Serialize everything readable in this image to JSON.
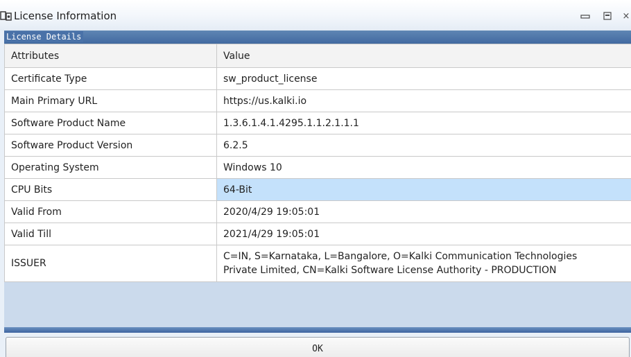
{
  "window": {
    "title": "License Information",
    "icons": {
      "app": "license-app-icon",
      "minimize": "minimize-icon",
      "maximize": "maximize-icon",
      "close": "close-icon"
    },
    "close_glyph": "×"
  },
  "group": {
    "legend": "License Details"
  },
  "table": {
    "columns": [
      "Attributes",
      "Value"
    ],
    "rows": [
      {
        "attribute": "Certificate Type",
        "value": "sw_product_license"
      },
      {
        "attribute": "Main Primary URL",
        "value": "https://us.kalki.io"
      },
      {
        "attribute": "Software Product Name",
        "value": "1.3.6.1.4.1.4295.1.1.2.1.1.1"
      },
      {
        "attribute": "Software Product Version",
        "value": "6.2.5"
      },
      {
        "attribute": "Operating System",
        "value": "Windows 10"
      },
      {
        "attribute": "CPU Bits",
        "value": "64-Bit",
        "selected": true
      },
      {
        "attribute": "Valid From",
        "value": "2020/4/29 19:05:01"
      },
      {
        "attribute": "Valid Till",
        "value": "2021/4/29 19:05:01"
      },
      {
        "attribute": "ISSUER",
        "value_line1": "C=IN, S=Karnataka, L=Bangalore, O=Kalki Communication Technologies",
        "value_line2": "Private Limited, CN=Kalki Software License Authority - PRODUCTION"
      }
    ]
  },
  "ok_button": {
    "label": "OK"
  },
  "colors": {
    "selected_row": "#c4e1fb",
    "group_bar": "#4a72a8",
    "panel_bg": "#cbdaec"
  }
}
